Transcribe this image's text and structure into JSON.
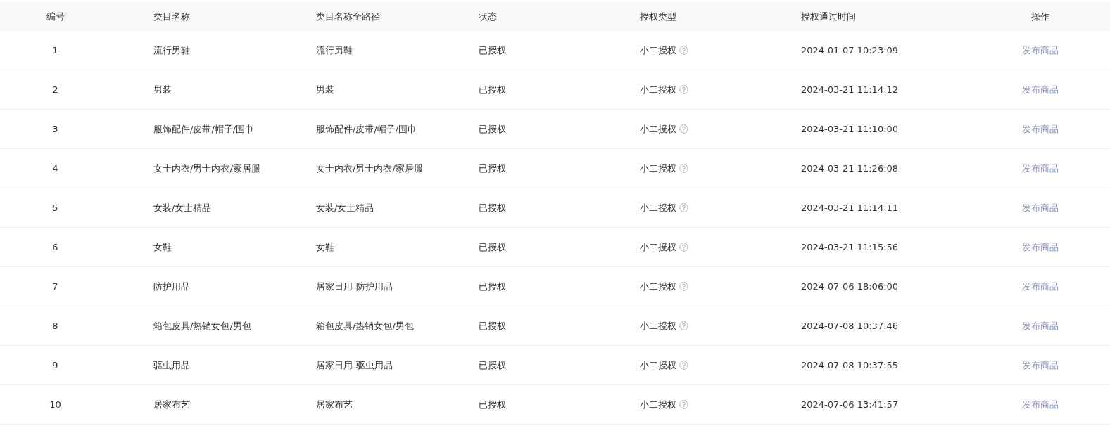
{
  "table": {
    "columns": [
      "编号",
      "类目名称",
      "类目名称全路径",
      "状态",
      "授权类型",
      "授权通过时间",
      "操作"
    ],
    "rows": [
      {
        "number": "1",
        "category": "流行男鞋",
        "full_path": "流行男鞋",
        "status": "已授权",
        "auth_type": "小二授权",
        "time": "2024-01-07 10:23:09",
        "action": "发布商品"
      },
      {
        "number": "2",
        "category": "男装",
        "full_path": "男装",
        "status": "已授权",
        "auth_type": "小二授权",
        "time": "2024-03-21 11:14:12",
        "action": "发布商品"
      },
      {
        "number": "3",
        "category": "服饰配件/皮带/帽子/围巾",
        "full_path": "服饰配件/皮带/帽子/围巾",
        "status": "已授权",
        "auth_type": "小二授权",
        "time": "2024-03-21 11:10:00",
        "action": "发布商品"
      },
      {
        "number": "4",
        "category": "女士内衣/男士内衣/家居服",
        "full_path": "女士内衣/男士内衣/家居服",
        "status": "已授权",
        "auth_type": "小二授权",
        "time": "2024-03-21 11:26:08",
        "action": "发布商品"
      },
      {
        "number": "5",
        "category": "女装/女士精品",
        "full_path": "女装/女士精品",
        "status": "已授权",
        "auth_type": "小二授权",
        "time": "2024-03-21 11:14:11",
        "action": "发布商品"
      },
      {
        "number": "6",
        "category": "女鞋",
        "full_path": "女鞋",
        "status": "已授权",
        "auth_type": "小二授权",
        "time": "2024-03-21 11:15:56",
        "action": "发布商品"
      },
      {
        "number": "7",
        "category": "防护用品",
        "full_path": "居家日用-防护用品",
        "status": "已授权",
        "auth_type": "小二授权",
        "time": "2024-07-06 18:06:00",
        "action": "发布商品"
      },
      {
        "number": "8",
        "category": "箱包皮具/热销女包/男包",
        "full_path": "箱包皮具/热销女包/男包",
        "status": "已授权",
        "auth_type": "小二授权",
        "time": "2024-07-08 10:37:46",
        "action": "发布商品"
      },
      {
        "number": "9",
        "category": "驱虫用品",
        "full_path": "居家日用-驱虫用品",
        "status": "已授权",
        "auth_type": "小二授权",
        "time": "2024-07-08 10:37:55",
        "action": "发布商品"
      },
      {
        "number": "10",
        "category": "居家布艺",
        "full_path": "居家布艺",
        "status": "已授权",
        "auth_type": "小二授权",
        "time": "2024-07-06 13:41:57",
        "action": "发布商品"
      }
    ]
  }
}
